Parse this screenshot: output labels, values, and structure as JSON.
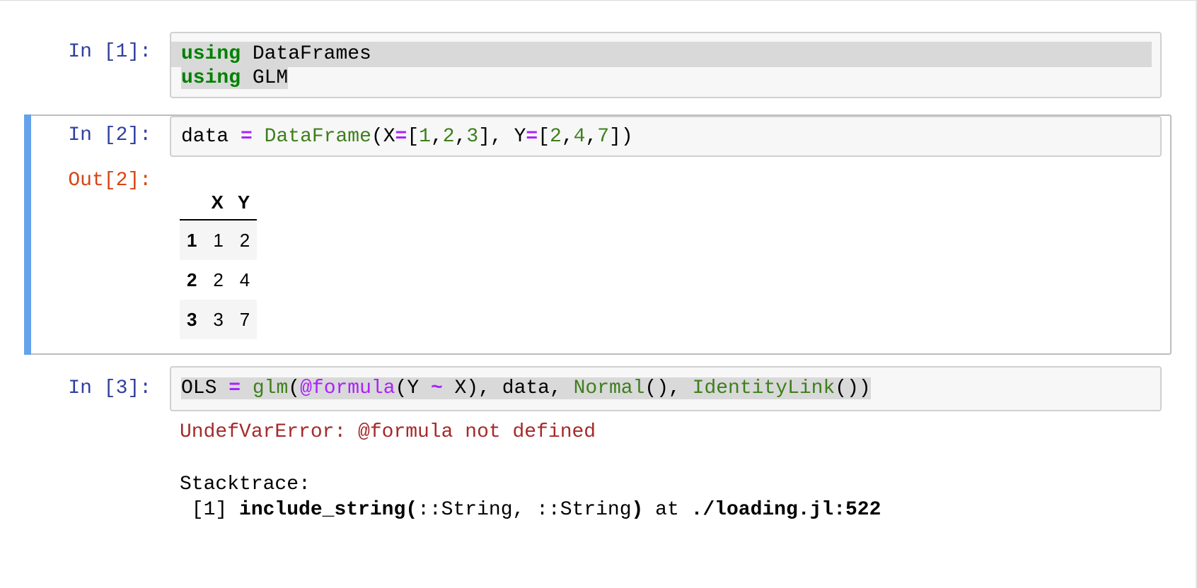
{
  "cells": [
    {
      "prompt": "In [1]:",
      "code": [
        {
          "kw": "using",
          "rest": " DataFrames"
        },
        {
          "kw": "using",
          "rest": " GLM"
        }
      ]
    },
    {
      "prompt": "In [2]:",
      "code_tokens": [
        "data",
        " ",
        "=",
        " ",
        "DataFrame",
        "(X",
        "=",
        "[",
        "1",
        ",",
        "2",
        ",",
        "3",
        "], Y",
        "=",
        "[",
        "2",
        ",",
        "4",
        ",",
        "7",
        "])"
      ],
      "out_prompt": "Out[2]:",
      "table": {
        "columns": [
          "",
          "X",
          "Y"
        ],
        "rows": [
          [
            "1",
            "1",
            "2"
          ],
          [
            "2",
            "2",
            "4"
          ],
          [
            "3",
            "3",
            "7"
          ]
        ]
      }
    },
    {
      "prompt": "In [3]:",
      "code_tokens": [
        "OLS",
        " ",
        "=",
        " ",
        "glm",
        "(",
        "@formula",
        "(Y ",
        "~",
        " X), data, ",
        "Normal",
        "(), ",
        "IdentityLink",
        "())"
      ],
      "error": {
        "title": "UndefVarError: @formula not defined",
        "stack_header": "Stacktrace:",
        "frame_index": " [1] ",
        "frame_func": "include_string",
        "frame_sig_open": "(",
        "frame_sig": "::String, ::String",
        "frame_sig_close": ")",
        "frame_at": " at ",
        "frame_loc": "./loading.jl:522"
      }
    }
  ],
  "colors": {
    "in_prompt": "#303f9f",
    "out_prompt": "#d84315",
    "keyword": "#008000",
    "operator": "#aa22ff",
    "builtin": "#3d7f1c",
    "error": "#a52a2a",
    "selected_bar": "#64a2eb"
  }
}
